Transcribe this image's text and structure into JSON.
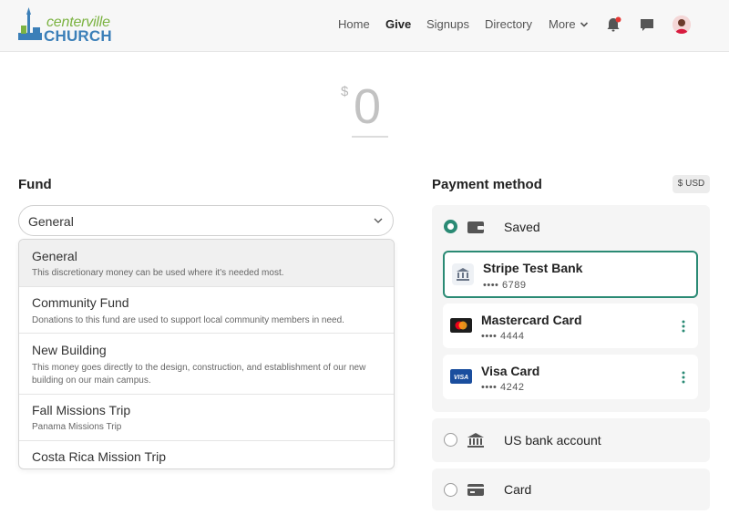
{
  "header": {
    "logo_top": "centerville",
    "logo_bottom": "CHURCH",
    "nav": [
      "Home",
      "Give",
      "Signups",
      "Directory"
    ],
    "more_label": "More",
    "icons": [
      "bell-icon",
      "chat-icon",
      "avatar"
    ]
  },
  "amount": {
    "currency_symbol": "$",
    "value": "0"
  },
  "fund": {
    "title": "Fund",
    "selected": "General",
    "options": [
      {
        "title": "General",
        "description": "This discretionary money can be used where it's needed most."
      },
      {
        "title": "Community Fund",
        "description": "Donations to this fund are used to support local community members in need."
      },
      {
        "title": "New Building",
        "description": "This money goes directly to the design, construction, and establishment of our new building on our main campus."
      },
      {
        "title": "Fall Missions Trip",
        "description": "Panama Missions Trip"
      },
      {
        "title": "Costa Rica Mission Trip",
        "description": ""
      }
    ]
  },
  "payment": {
    "title": "Payment method",
    "currency_badge": "$ USD",
    "saved_label": "Saved",
    "saved_methods": [
      {
        "name": "Stripe Test Bank",
        "number": "•••• 6789",
        "type": "bank"
      },
      {
        "name": "Mastercard Card",
        "number": "•••• 4444",
        "type": "mastercard"
      },
      {
        "name": "Visa Card",
        "number": "•••• 4242",
        "type": "visa"
      }
    ],
    "us_bank_label": "US bank account",
    "card_label": "Card"
  },
  "colors": {
    "accent": "#2a8a74",
    "logo_green": "#7cb342",
    "logo_blue": "#3b7fb8"
  }
}
